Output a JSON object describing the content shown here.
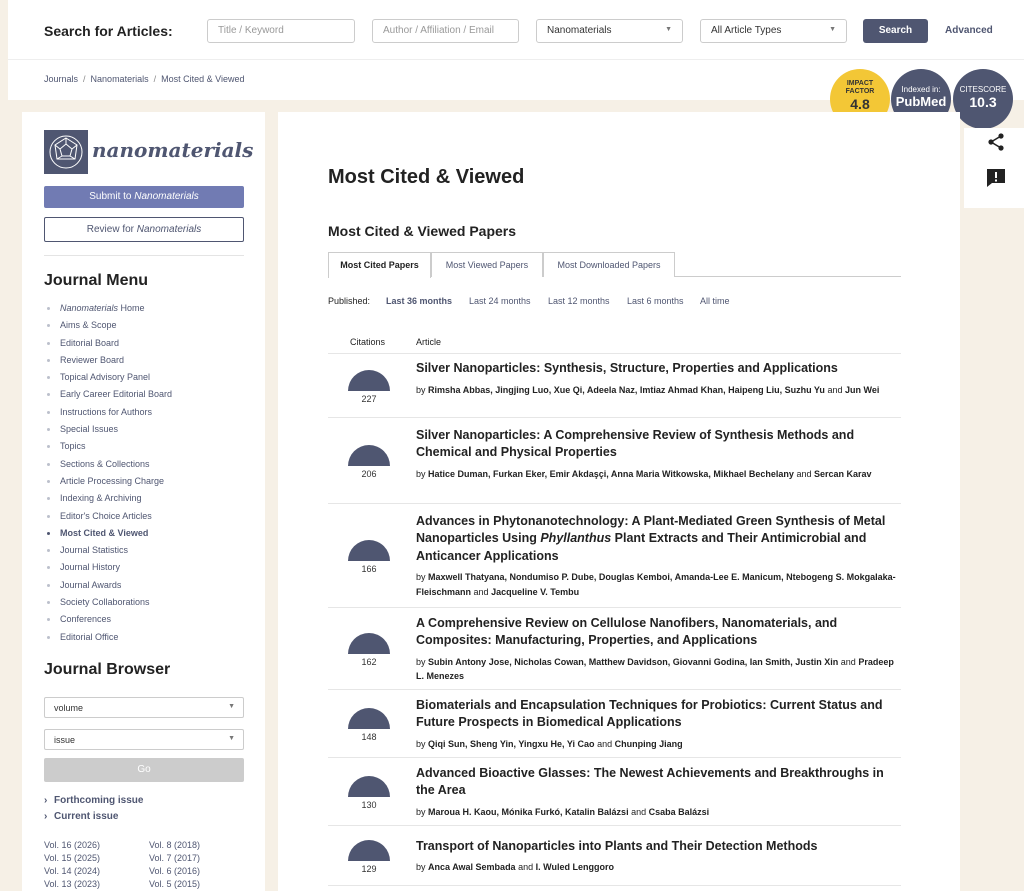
{
  "search": {
    "label": "Search for Articles:",
    "title_placeholder": "Title / Keyword",
    "author_placeholder": "Author / Affiliation / Email",
    "journal_value": "Nanomaterials",
    "type_value": "All Article Types",
    "search_button": "Search",
    "advanced_link": "Advanced"
  },
  "breadcrumb": [
    "Journals",
    "Nanomaterials",
    "Most Cited & Viewed"
  ],
  "badges": {
    "impact_label_1": "IMPACT",
    "impact_label_2": "FACTOR",
    "impact_value": "4.8",
    "indexed_label": "Indexed in:",
    "indexed_value": "PubMed",
    "citescore_label": "CITESCORE",
    "citescore_value": "10.3"
  },
  "sidebar": {
    "logo_text": "nanomaterials",
    "submit_prefix": "Submit to ",
    "submit_journal": "Nanomaterials",
    "review_prefix": "Review for ",
    "review_journal": "Nanomaterials",
    "menu_heading": "Journal Menu",
    "menu_home_journal": "Nanomaterials",
    "menu_home_suffix": " Home",
    "menu": [
      "Aims & Scope",
      "Editorial Board",
      "Reviewer Board",
      "Topical Advisory Panel",
      "Early Career Editorial Board",
      "Instructions for Authors",
      "Special Issues",
      "Topics",
      "Sections & Collections",
      "Article Processing Charge",
      "Indexing & Archiving",
      "Editor's Choice Articles",
      "Most Cited & Viewed",
      "Journal Statistics",
      "Journal History",
      "Journal Awards",
      "Society Collaborations",
      "Conferences",
      "Editorial Office"
    ],
    "browser_heading": "Journal Browser",
    "volume_select": "volume",
    "issue_select": "issue",
    "go_button": "Go",
    "forthcoming": "Forthcoming issue",
    "current": "Current issue",
    "volumes_left": [
      "Vol. 16 (2026)",
      "Vol. 15 (2025)",
      "Vol. 14 (2024)",
      "Vol. 13 (2023)"
    ],
    "volumes_right": [
      "Vol. 8 (2018)",
      "Vol. 7 (2017)",
      "Vol. 6 (2016)",
      "Vol. 5 (2015)"
    ]
  },
  "main": {
    "title": "Most Cited & Viewed",
    "subtitle": "Most Cited & Viewed Papers",
    "tabs": [
      "Most Cited Papers",
      "Most Viewed Papers",
      "Most Downloaded Papers"
    ],
    "published_label": "Published:",
    "periods": [
      "Last 36 months",
      "Last 24 months",
      "Last 12 months",
      "Last 6 months",
      "All time"
    ],
    "col_citations": "Citations",
    "col_article": "Article",
    "articles": [
      {
        "citations": "227",
        "title": "Silver Nanoparticles: Synthesis, Structure, Properties and Applications",
        "authors": "Rimsha Abbas, Jingjing Luo, Xue Qi, Adeela Naz, Imtiaz Ahmad Khan, Haipeng Liu, Suzhu Yu",
        "authors_last": "Jun Wei"
      },
      {
        "citations": "206",
        "title": "Silver Nanoparticles: A Comprehensive Review of Synthesis Methods and Chemical and Physical Properties",
        "authors": "Hatice Duman, Furkan Eker, Emir Akdaşçi, Anna Maria Witkowska, Mikhael Bechelany",
        "authors_last": "Sercan Karav"
      },
      {
        "citations": "166",
        "title_pre": "Advances in Phytonanotechnology: A Plant-Mediated Green Synthesis of Metal Nanoparticles Using ",
        "title_italic": "Phyllanthus",
        "title_post": " Plant Extracts and Their Antimicrobial and Anticancer Applications",
        "authors": "Maxwell Thatyana, Nondumiso P. Dube, Douglas Kemboi, Amanda-Lee E. Manicum, Ntebogeng S. Mokgalaka-Fleischmann",
        "authors_last": "Jacqueline V. Tembu"
      },
      {
        "citations": "162",
        "title": "A Comprehensive Review on Cellulose Nanofibers, Nanomaterials, and Composites: Manufacturing, Properties, and Applications",
        "authors": "Subin Antony Jose, Nicholas Cowan, Matthew Davidson, Giovanni Godina, Ian Smith, Justin Xin",
        "authors_last": "Pradeep L. Menezes"
      },
      {
        "citations": "148",
        "title": "Biomaterials and Encapsulation Techniques for Probiotics: Current Status and Future Prospects in Biomedical Applications",
        "authors": "Qiqi Sun, Sheng Yin, Yingxu He, Yi Cao",
        "authors_last": "Chunping Jiang"
      },
      {
        "citations": "130",
        "title": "Advanced Bioactive Glasses: The Newest Achievements and Breakthroughs in the Area",
        "authors": "Maroua H. Kaou, Mónika Furkó, Katalin Balázsi",
        "authors_last": "Csaba Balázsi"
      },
      {
        "citations": "129",
        "title": "Transport of Nanoparticles into Plants and Their Detection Methods",
        "authors": "Anca Awal Sembada",
        "authors_last": "I. Wuled Lenggoro"
      }
    ],
    "and_word": "and",
    "by_word": "by"
  }
}
